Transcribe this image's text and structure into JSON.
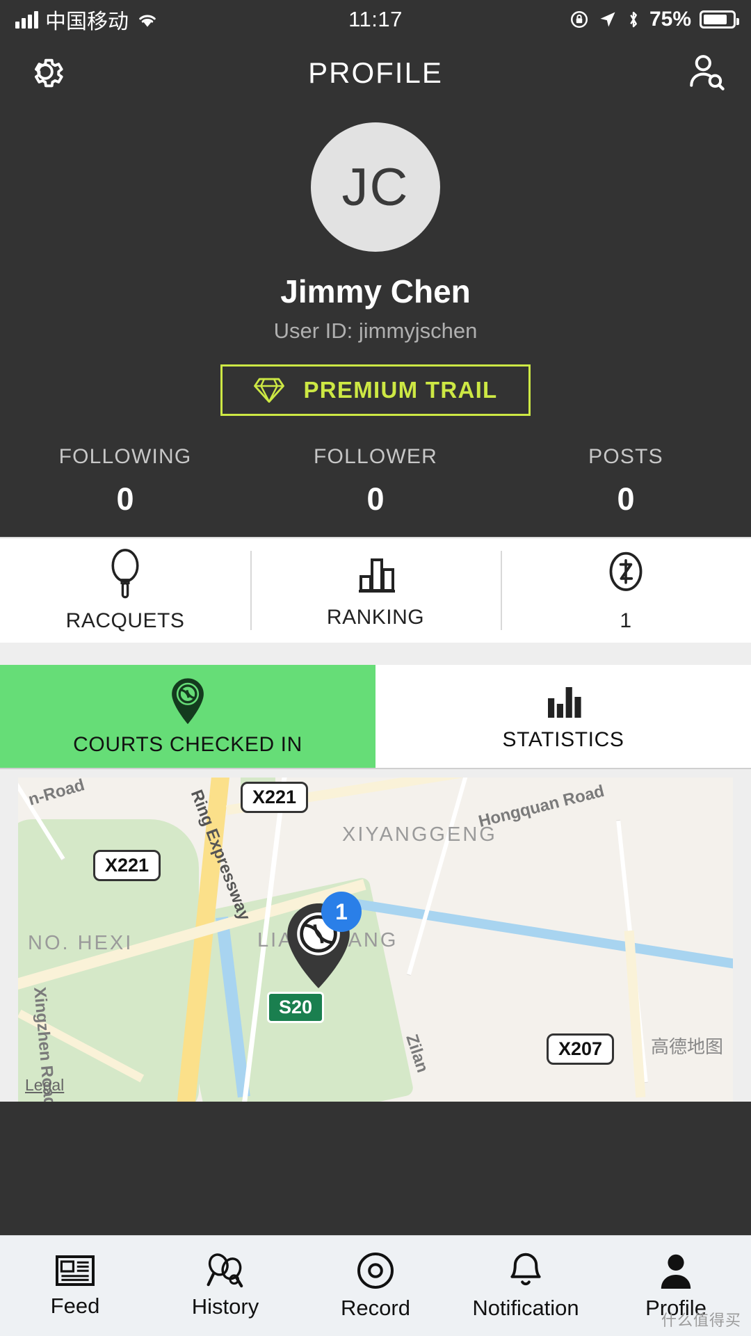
{
  "statusbar": {
    "carrier": "中国移动",
    "wifi_icon": "wifi-icon",
    "signal_icon": "signal-bars-icon",
    "time": "11:17",
    "orientation_lock_icon": "orientation-lock-icon",
    "location_icon": "location-arrow-icon",
    "bluetooth_icon": "bluetooth-icon",
    "battery_percent": "75%",
    "battery_icon": "battery-icon"
  },
  "navbar": {
    "title": "PROFILE",
    "settings_icon": "gear-icon",
    "find_friends_icon": "person-search-icon"
  },
  "profile": {
    "avatar_initials": "JC",
    "name": "Jimmy Chen",
    "user_id": "User ID: jimmyjschen",
    "premium_label": "PREMIUM TRAIL",
    "premium_icon": "diamond-icon",
    "premium_color": "#cde844",
    "stats": [
      {
        "label": "FOLLOWING",
        "value": "0"
      },
      {
        "label": "FOLLOWER",
        "value": "0"
      },
      {
        "label": "POSTS",
        "value": "0"
      }
    ]
  },
  "icon_row": [
    {
      "label": "RACQUETS",
      "icon": "racquet-icon"
    },
    {
      "label": "RANKING",
      "icon": "bar-chart-icon"
    },
    {
      "label": "1",
      "icon": "badge-circle-icon"
    }
  ],
  "segments": {
    "active_color": "#66dd77",
    "items": [
      {
        "label": "COURTS CHECKED IN",
        "icon": "court-pin-icon",
        "active": true
      },
      {
        "label": "STATISTICS",
        "icon": "bar-chart-icon",
        "active": false
      }
    ]
  },
  "map": {
    "shields": [
      "X221",
      "X221",
      "S20",
      "X207"
    ],
    "area_labels": [
      "XIYANGGENG",
      "NO. HEXI",
      "LIANGJIANG"
    ],
    "road_labels": [
      "n-Road",
      "Ring Expressway",
      "Hongquan Road",
      "Xingzhen Road",
      "Zilan"
    ],
    "marker_count": "1",
    "marker_icon": "tennis-court-pin-icon",
    "attribution": "高德地图",
    "legal": "Legal"
  },
  "tabbar": [
    {
      "label": "Feed",
      "icon": "feed-icon"
    },
    {
      "label": "History",
      "icon": "racquets-history-icon"
    },
    {
      "label": "Record",
      "icon": "record-icon"
    },
    {
      "label": "Notification",
      "icon": "bell-icon"
    },
    {
      "label": "Profile",
      "icon": "person-icon"
    }
  ],
  "watermark": "什么值得买"
}
